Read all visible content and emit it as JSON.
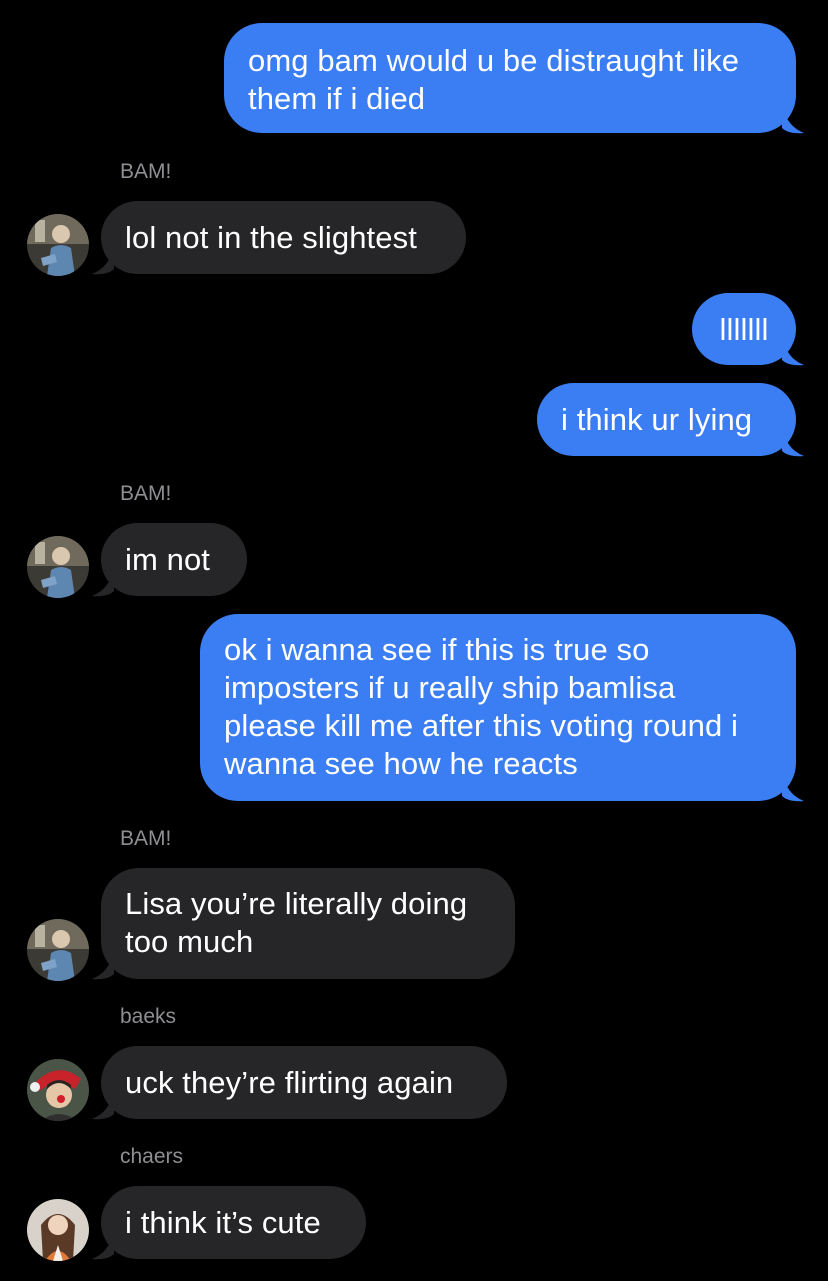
{
  "conversation": {
    "messages": [
      {
        "sender": "",
        "direction": "outgoing",
        "text": "omg bam would u be distraught like them if i died"
      },
      {
        "sender": "BAM!",
        "direction": "incoming",
        "text": "lol not in the slightest"
      },
      {
        "sender": "",
        "direction": "outgoing",
        "text": "lllllll"
      },
      {
        "sender": "",
        "direction": "outgoing",
        "text": "i think ur lying"
      },
      {
        "sender": "BAM!",
        "direction": "incoming",
        "text": "im not"
      },
      {
        "sender": "",
        "direction": "outgoing",
        "text": "ok i wanna see if this is true so imposters if u really ship bamlisa please kill me after this voting round i wanna see how he reacts"
      },
      {
        "sender": "BAM!",
        "direction": "incoming",
        "text": "Lisa you’re literally doing too much"
      },
      {
        "sender": "baeks",
        "direction": "incoming",
        "text": "uck they’re flirting again"
      },
      {
        "sender": "chaers",
        "direction": "incoming",
        "text": "i think it’s cute"
      }
    ]
  },
  "colors": {
    "background": "#000000",
    "outgoing_bubble": "#3b7df2",
    "incoming_bubble": "#262628",
    "sender_name": "#8e8e93"
  },
  "icons": {
    "avatar_bam": "avatar-bam-icon",
    "avatar_baeks": "avatar-baeks-icon",
    "avatar_chaers": "avatar-chaers-icon"
  }
}
